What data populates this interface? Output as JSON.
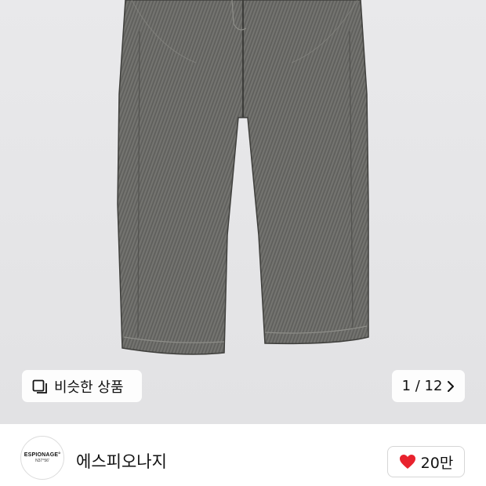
{
  "product_image": {
    "alt": "gray wide denim pants"
  },
  "gallery": {
    "similar_label": "비슷한 상품",
    "similar_icon": "similar-products-icon",
    "counter": "1 / 12",
    "next_icon": "chevron-right-icon"
  },
  "brand": {
    "logo_line1": "ESPIONAGE°",
    "logo_line2": "N37°56'",
    "name": "에스피오나지"
  },
  "like": {
    "count": "20만",
    "icon": "heart-icon",
    "color": "#e8222d"
  }
}
